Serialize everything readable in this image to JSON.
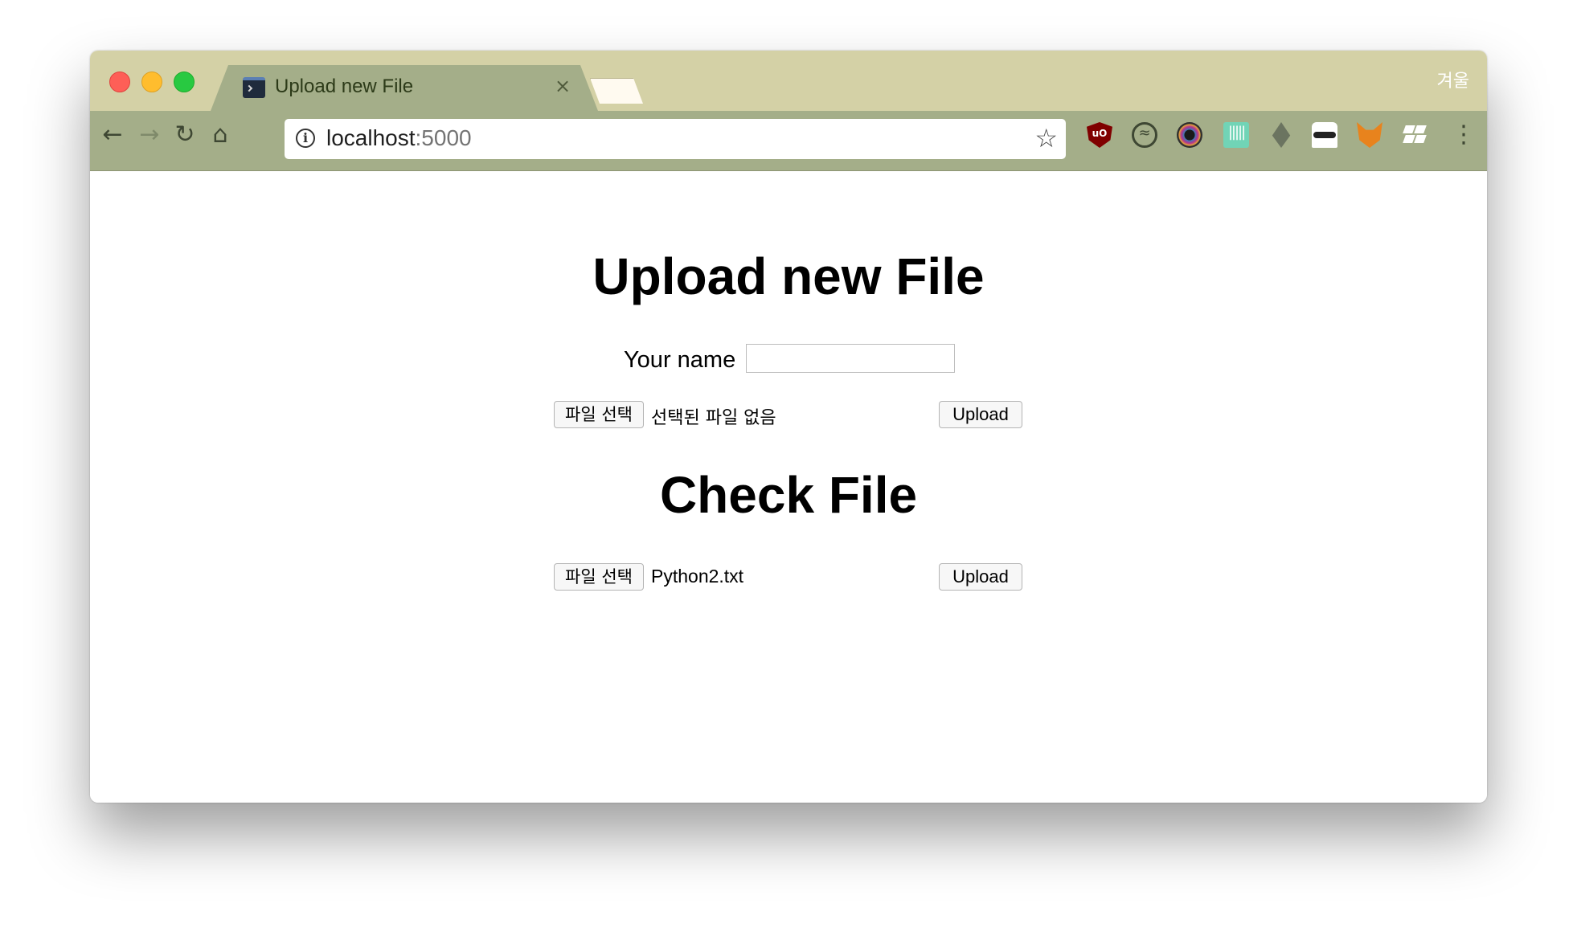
{
  "browser": {
    "tab_title": "Upload new File",
    "tab_close": "×",
    "profile_name": "겨울",
    "url_host": "localhost",
    "url_port": ":5000",
    "nav": {
      "back": "←",
      "forward": "→",
      "reload": "↻",
      "home": "⌂",
      "menu": "⋮",
      "info": "i",
      "bookmark": "☆"
    },
    "extensions": [
      "ublock-origin-icon",
      "sync-icon",
      "color-lens-icon",
      "audio-wave-icon",
      "ethereum-icon",
      "incognito-mask-icon",
      "metamask-fox-icon",
      "dropbox-icon"
    ],
    "extension_labels": {
      "ublock": "uO",
      "sync": "≈",
      "sound": "|||||"
    },
    "colors": {
      "titlebar": "#d4d1a6",
      "toolbar": "#a4ae89",
      "tab_active": "#a4ae89"
    }
  },
  "upload_section": {
    "heading": "Upload new File",
    "name_label": "Your name",
    "name_value": "",
    "choose_file_label": "파일 선택",
    "file_status": "선택된 파일 없음",
    "submit_label": "Upload"
  },
  "check_section": {
    "heading": "Check File",
    "choose_file_label": "파일 선택",
    "file_status": "Python2.txt",
    "submit_label": "Upload"
  }
}
